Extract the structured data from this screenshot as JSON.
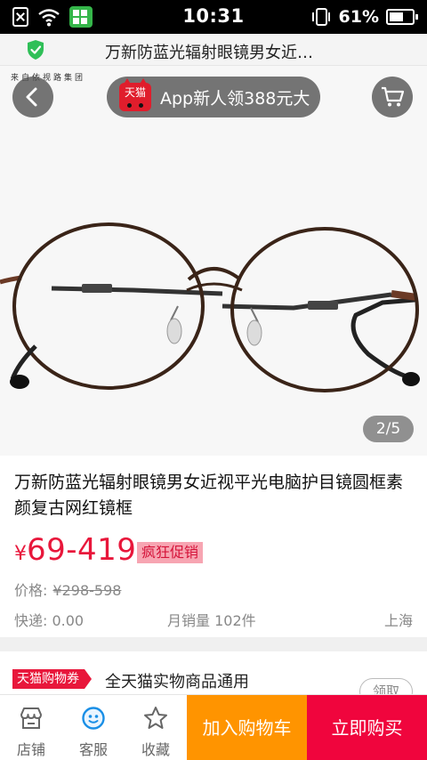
{
  "status_bar": {
    "time": "10:31",
    "battery_text": "61%",
    "battery_level": 0.61,
    "icons": [
      "notification-blocked-icon",
      "wifi-icon",
      "app-notification-icon",
      "phone-vibrate-icon",
      "battery-icon"
    ]
  },
  "title_bar": {
    "title": "万新防蓝光辐射眼镜男女近…",
    "secure_icon": "shield-check-icon",
    "accent": "#2fbf57"
  },
  "gallery": {
    "brand_line": "来自依视路集团",
    "promo": {
      "logo_text": "天猫",
      "text": "App新人领388元大"
    },
    "pager": "2/5"
  },
  "product": {
    "title": "万新防蓝光辐射眼镜男女近视平光电脑护目镜圆框素颜复古网红镜框",
    "price_currency": "¥",
    "price_value": "69-419",
    "sale_tag": "疯狂促销",
    "original_label": "价格:",
    "original_value": "¥298-598",
    "express": "快递: 0.00",
    "monthly_sales": "月销量 102件",
    "location": "上海",
    "price_color": "#e8173b"
  },
  "coupon": {
    "badge": "天猫购物券",
    "text": "全天猫实物商品通用",
    "claim_label": "领取"
  },
  "bottom_bar": {
    "store_label": "店铺",
    "service_label": "客服",
    "favorite_label": "收藏",
    "add_cart_label": "加入购物车",
    "buy_now_label": "立即购买",
    "add_cart_color": "#ff9400",
    "buy_now_color": "#f0053d"
  }
}
